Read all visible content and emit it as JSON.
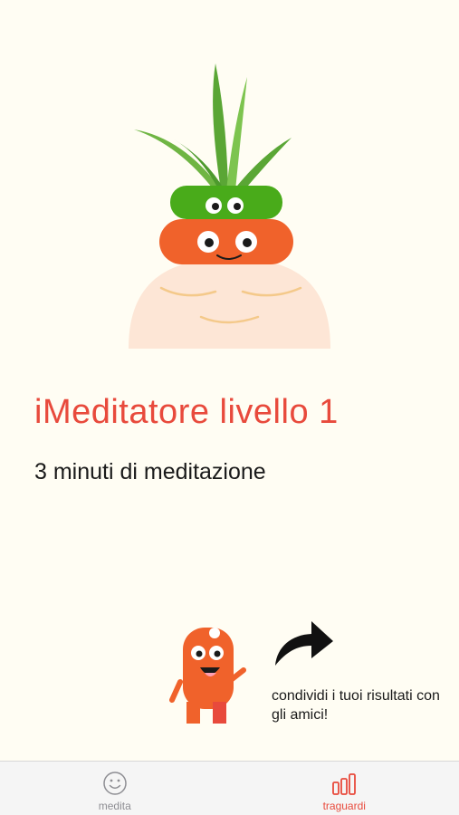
{
  "achievement": {
    "title": "iMeditatore livello 1",
    "subtitle": "3 minuti di meditazione"
  },
  "share": {
    "text": "condividi i tuoi risultati con gli amici!"
  },
  "tabbar": {
    "tabs": [
      {
        "label": "medita",
        "icon": "smiley-icon",
        "active": false
      },
      {
        "label": "traguardi",
        "icon": "bar-chart-icon",
        "active": true
      }
    ]
  },
  "colors": {
    "accent": "#e84a3c",
    "background": "#fffdf3",
    "inactive": "#8e8e93",
    "orange": "#f0622b",
    "green": "#49ab1a"
  }
}
